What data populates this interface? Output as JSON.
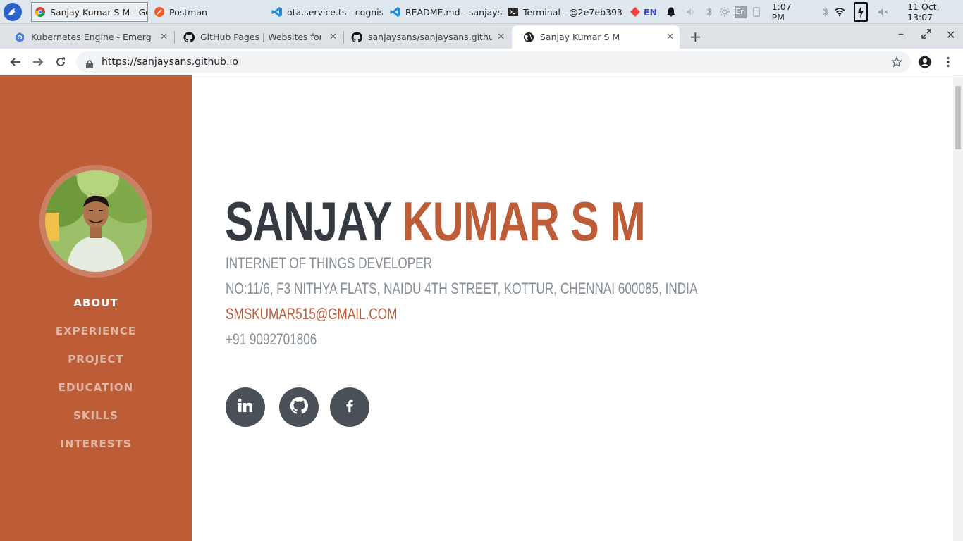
{
  "taskbar": {
    "tasks": [
      {
        "label": "Sanjay Kumar S M - Go..."
      },
      {
        "label": "Postman"
      },
      {
        "label": "ota.service.ts - cognise..."
      },
      {
        "label": "README.md - sanjaysa..."
      },
      {
        "label": "Terminal - @2e7eb393..."
      }
    ],
    "lang": "EN",
    "kbd": "En",
    "time": "1:07 PM",
    "date": "11 Oct, 13:07"
  },
  "browser": {
    "tabs": [
      {
        "title": "Kubernetes Engine - Emerging"
      },
      {
        "title": "GitHub Pages | Websites for yo"
      },
      {
        "title": "sanjaysans/sanjaysans.github.io"
      },
      {
        "title": "Sanjay Kumar S M"
      }
    ],
    "url": "https://sanjaysans.github.io"
  },
  "sidebar": {
    "nav": [
      "ABOUT",
      "EXPERIENCE",
      "PROJECT",
      "EDUCATION",
      "SKILLS",
      "INTERESTS"
    ]
  },
  "profile": {
    "first_name": "SANJAY",
    "last_name": "KUMAR S M",
    "role": "Internet of Things Developer",
    "address": "No:11/6, F3 Nithya Flats, Naidu 4th Street, Kottur, Chennai 600085, India",
    "email": "SMSKUMAR515@GMAIL.COM",
    "phone": "+91 9092701806"
  },
  "social": [
    {
      "icon": "linkedin-icon"
    },
    {
      "icon": "github-icon"
    },
    {
      "icon": "facebook-icon"
    }
  ],
  "colors": {
    "accent": "#bd5d38",
    "dark": "#343a40",
    "muted": "#868e96",
    "social_bg": "#495057"
  }
}
